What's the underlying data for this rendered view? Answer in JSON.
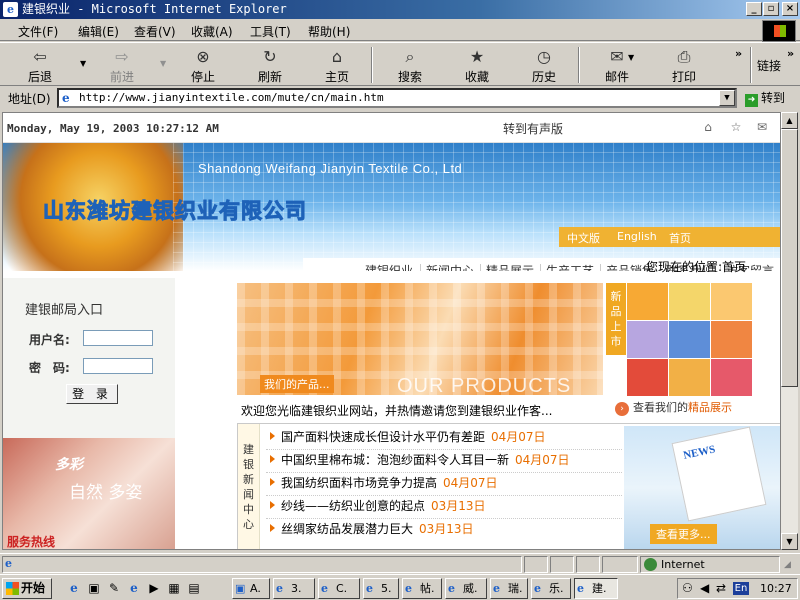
{
  "window": {
    "title": "建银织业 - Microsoft Internet Explorer"
  },
  "menu": {
    "items": [
      "文件(F)",
      "编辑(E)",
      "查看(V)",
      "收藏(A)",
      "工具(T)",
      "帮助(H)"
    ]
  },
  "toolbar": {
    "back": "后退",
    "forward": "前进",
    "stop": "停止",
    "refresh": "刷新",
    "home": "主页",
    "search": "搜索",
    "favorites": "收藏",
    "history": "历史",
    "mail": "邮件",
    "print": "打印",
    "links": "链接"
  },
  "address": {
    "label": "地址(D)",
    "url": "http://www.jianyintextile.com/mute/cn/main.htm",
    "go": "转到"
  },
  "page": {
    "datetime": "Monday, May 19, 2003 10:27:12 AM",
    "audio_version": "转到有声版",
    "banner_en": "Shandong Weifang Jianyin Textile Co., Ltd",
    "banner_cn": "山东潍坊建银织业有限公司",
    "lang_tabs": [
      "中文版",
      "English",
      "首页"
    ],
    "nav": [
      "建银织业",
      "新闻中心",
      "精品展示",
      "生产工艺",
      "产品销售",
      "联系我们",
      "访客留言"
    ],
    "location": "您现在的位置:首页",
    "mail_login_title": "建银邮局入口",
    "username_label": "用户名:",
    "password_label": "密　码:",
    "login_button": "登 录",
    "promo_text": "自然 多姿",
    "promo_logo": "多彩",
    "hotline": "服务热线",
    "products_tag": "我们的产品...",
    "products_en": "OUR PRODUCTS",
    "new_tag": "新品上市",
    "welcome": "欢迎您光临建银织业网站，并热情邀请您到建银织业作客...",
    "showcase_prefix": "查看我们的",
    "showcase_link": "精品展示",
    "news_label": "建银新闻中心",
    "news": [
      {
        "title": "国产面料快速成长但设计水平仍有差距",
        "date": "04月07日"
      },
      {
        "title": "中国织里棉布城：泡泡纱面料令人耳目一新",
        "date": "04月07日"
      },
      {
        "title": "我国纺织面料市场竞争力提高",
        "date": "04月07日"
      },
      {
        "title": "纱线——纺织业创意的起点",
        "date": "03月13日"
      },
      {
        "title": "丝绸家纺品发展潜力巨大",
        "date": "03月13日"
      }
    ],
    "news_pic_text": "NEWS",
    "news_more": "查看更多..."
  },
  "status": {
    "zone": "Internet"
  },
  "taskbar": {
    "start": "开始",
    "tasks": [
      "A.",
      "3.",
      "C.",
      "5.",
      "帖.",
      "威.",
      "瑞.",
      "乐.",
      "建."
    ],
    "active_index": 8,
    "clock": "10:27",
    "ime": "En"
  }
}
